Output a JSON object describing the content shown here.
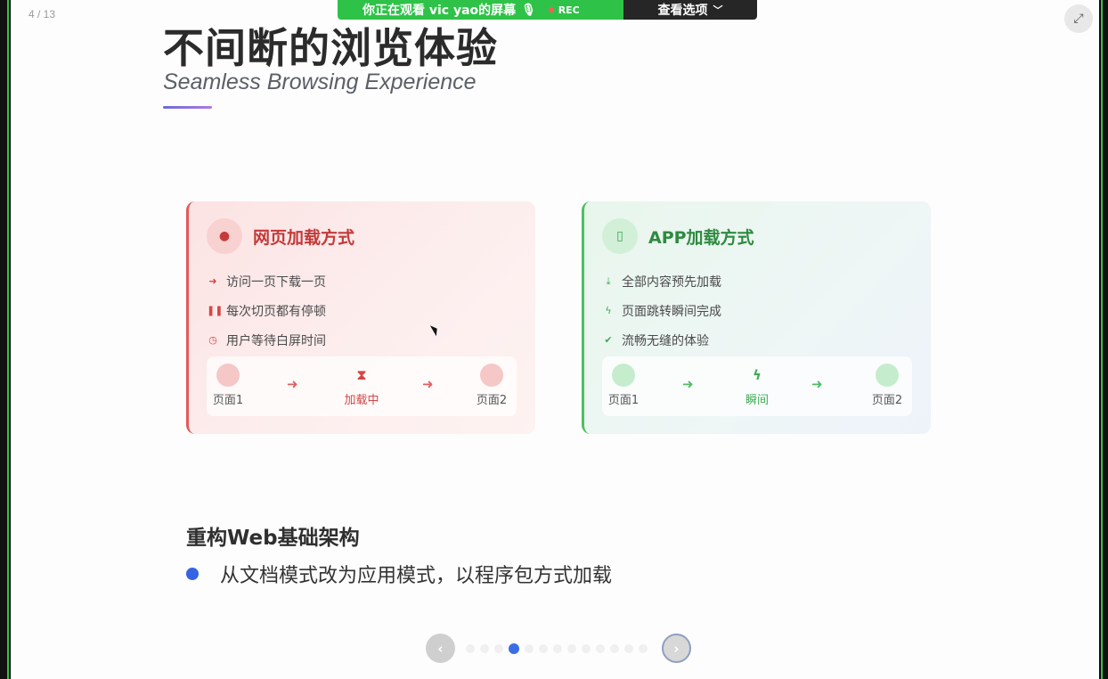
{
  "page_counter": "4 / 13",
  "share_banner": {
    "text": "你正在观看 vic yao的屏幕",
    "rec": "REC",
    "options": "查看选项"
  },
  "title": {
    "cn": "不间断的浏览体验",
    "en": "Seamless Browsing Experience"
  },
  "cards": {
    "web": {
      "icon": "globe-icon",
      "title": "网页加载方式",
      "items": [
        {
          "icon": "arrow-right-icon",
          "text": "访问一页下载一页"
        },
        {
          "icon": "pause-icon",
          "text": "每次切页都有停顿"
        },
        {
          "icon": "clock-icon",
          "text": "用户等待白屏时间"
        }
      ],
      "flow": {
        "start": "页面1",
        "middle": "加载中",
        "end": "页面2"
      },
      "accent": "#e25a5a"
    },
    "app": {
      "icon": "mobile-icon",
      "title": "APP加载方式",
      "items": [
        {
          "icon": "download-icon",
          "text": "全部内容预先加载"
        },
        {
          "icon": "bolt-icon",
          "text": "页面跳转瞬间完成"
        },
        {
          "icon": "check-circle-icon",
          "text": "流畅无缝的体验"
        }
      ],
      "flow": {
        "start": "页面1",
        "middle": "瞬间",
        "end": "页面2"
      },
      "accent": "#4fbf63"
    }
  },
  "section": {
    "heading": "重构Web基础架构",
    "bullet": "从文档模式改为应用模式，以程序包方式加载"
  },
  "pager": {
    "total": 13,
    "current": 4
  }
}
